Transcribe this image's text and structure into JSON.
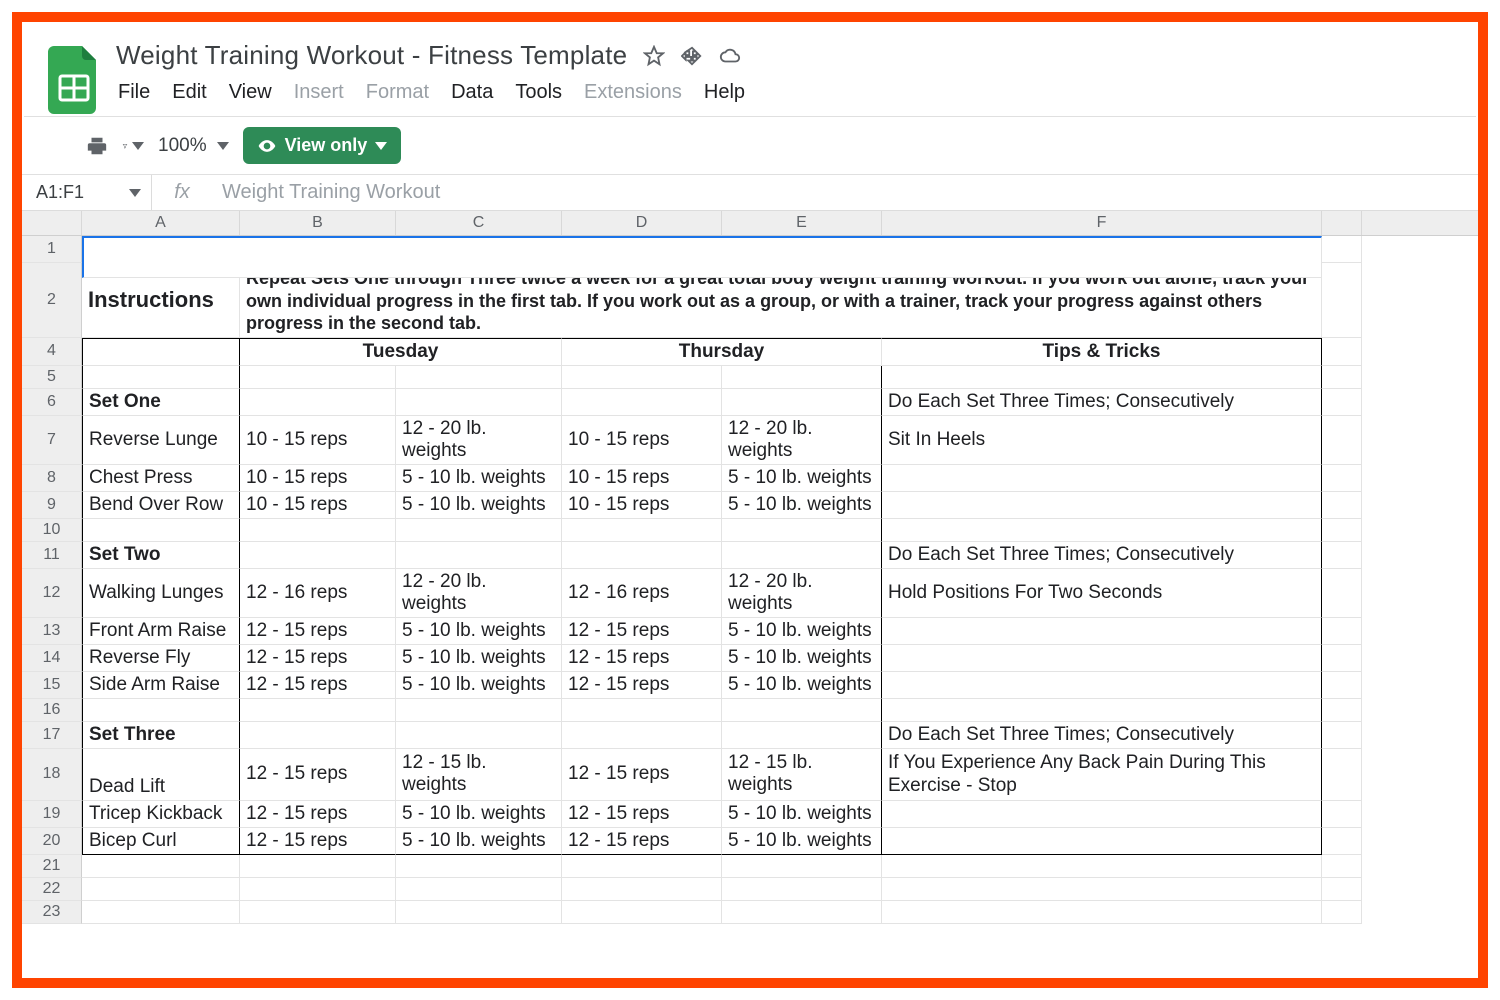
{
  "app": {
    "title": "Weight Training Workout - Fitness Template",
    "menus": [
      "File",
      "Edit",
      "View",
      "Insert",
      "Format",
      "Data",
      "Tools",
      "Extensions",
      "Help"
    ],
    "menus_disabled": [
      "Insert",
      "Format",
      "Extensions"
    ],
    "zoom": "100%",
    "view_only": "View only",
    "name_box": "A1:F1",
    "formula_text": "Weight Training Workout",
    "col_headers": [
      "A",
      "B",
      "C",
      "D",
      "E",
      "F"
    ]
  },
  "sheet": {
    "title_cell": "Weight Training Workout",
    "instructions_label": "Instructions",
    "instructions_text": "Repeat Sets One through Three twice a week for a great total body weight training workout.  If you work out alone, track your own individual progress in the first tab.  If you work out as a group, or with a trainer, track your progress against others progress in the second tab.",
    "day_headers": {
      "tuesday": "Tuesday",
      "thursday": "Thursday",
      "tips": "Tips & Tricks"
    },
    "rows": [
      {
        "n": 4,
        "a": "",
        "b": "",
        "c": "",
        "d": "",
        "e": ""
      },
      {
        "n": 5,
        "a": "",
        "b": "",
        "c": "",
        "d": "",
        "e": "",
        "f": ""
      },
      {
        "n": 6,
        "a": "Set One",
        "bold": true,
        "f": "Do Each Set Three Times; Consecutively"
      },
      {
        "n": 7,
        "a": "Reverse Lunge",
        "b": "10 - 15 reps",
        "c": "12 - 20 lb. weights",
        "d": "10 - 15 reps",
        "e": "12 - 20 lb. weights",
        "f": "Sit In Heels"
      },
      {
        "n": 8,
        "a": "Chest Press",
        "b": "10 - 15 reps",
        "c": "5 - 10 lb. weights",
        "d": "10 - 15 reps",
        "e": "5 - 10 lb. weights",
        "f": ""
      },
      {
        "n": 9,
        "a": "Bend Over Row",
        "b": "10 - 15 reps",
        "c": "5 - 10 lb. weights",
        "d": "10 - 15 reps",
        "e": "5 - 10 lb. weights",
        "f": ""
      },
      {
        "n": 10
      },
      {
        "n": 11,
        "a": "Set Two",
        "bold": true,
        "f": "Do Each Set Three Times; Consecutively"
      },
      {
        "n": 12,
        "a": "Walking Lunges",
        "b": "12 - 16 reps",
        "c": "12 - 20 lb. weights",
        "d": "12 - 16 reps",
        "e": "12 - 20 lb. weights",
        "f": "Hold Positions For Two Seconds"
      },
      {
        "n": 13,
        "a": "Front Arm Raise",
        "b": "12 - 15 reps",
        "c": "5 - 10 lb. weights",
        "d": "12 - 15 reps",
        "e": "5 - 10 lb. weights",
        "f": ""
      },
      {
        "n": 14,
        "a": "Reverse Fly",
        "b": "12 - 15 reps",
        "c": "5 - 10 lb. weights",
        "d": "12 - 15 reps",
        "e": "5 - 10 lb. weights",
        "f": ""
      },
      {
        "n": 15,
        "a": "Side Arm Raise",
        "b": "12 - 15 reps",
        "c": "5 - 10 lb. weights",
        "d": "12 - 15 reps",
        "e": "5 - 10 lb. weights",
        "f": ""
      },
      {
        "n": 16
      },
      {
        "n": 17,
        "a": "Set Three",
        "bold": true,
        "f": "Do Each Set Three Times; Consecutively"
      },
      {
        "n": 18,
        "a": "Dead Lift",
        "b": "12 - 15 reps",
        "c": "12 - 15 lb. weights",
        "d": "12 - 15 reps",
        "e": "12 - 15 lb. weights",
        "f": "If You Experience Any Back Pain During This Exercise - Stop",
        "tall": true
      },
      {
        "n": 19,
        "a": "Tricep Kickback",
        "b": "12 - 15 reps",
        "c": "5 - 10 lb. weights",
        "d": "12 - 15 reps",
        "e": "5 - 10 lb. weights",
        "f": ""
      },
      {
        "n": 20,
        "a": "Bicep Curl",
        "b": "12 - 15 reps",
        "c": "5 - 10 lb. weights",
        "d": "12 - 15 reps",
        "e": "5 - 10 lb. weights",
        "f": ""
      },
      {
        "n": 21
      },
      {
        "n": 22
      },
      {
        "n": 23
      }
    ]
  }
}
